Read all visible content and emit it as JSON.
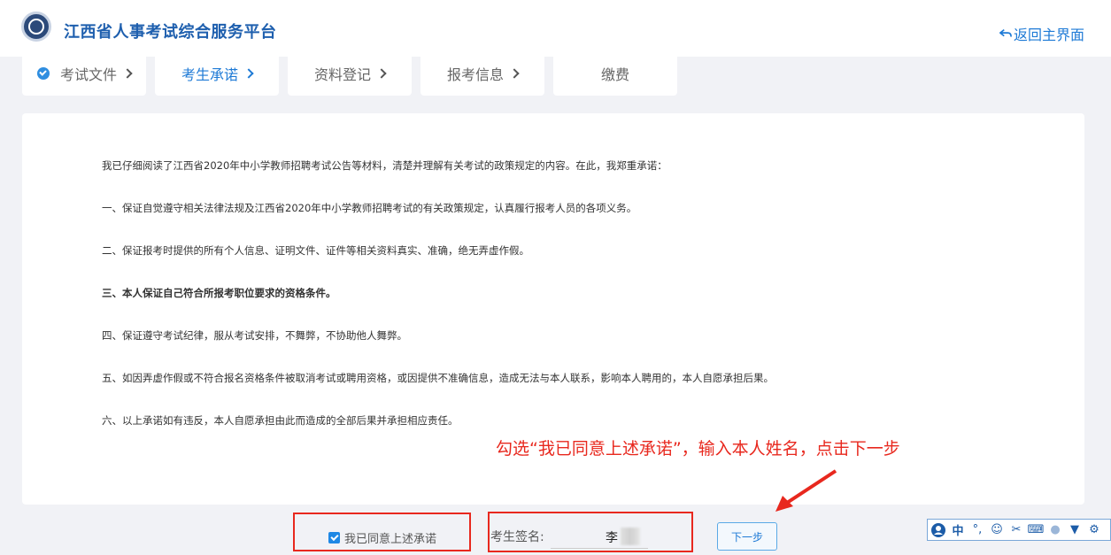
{
  "header": {
    "title": "江西省人事考试综合服务平台",
    "back_label": "返回主界面"
  },
  "steps": [
    {
      "label": "考试文件",
      "state": "done"
    },
    {
      "label": "考生承诺",
      "state": "active"
    },
    {
      "label": "资料登记",
      "state": "pending"
    },
    {
      "label": "报考信息",
      "state": "pending"
    },
    {
      "label": "缴费",
      "state": "pending"
    }
  ],
  "pledge": {
    "intro": "我已仔细阅读了江西省2020年中小学教师招聘考试公告等材料，清楚并理解有关考试的政策规定的内容。在此，我郑重承诺：",
    "items": [
      "一、保证自觉遵守相关法律法规及江西省2020年中小学教师招聘考试的有关政策规定，认真履行报考人员的各项义务。",
      "二、保证报考时提供的所有个人信息、证明文件、证件等相关资料真实、准确，绝无弄虚作假。",
      "三、本人保证自己符合所报考职位要求的资格条件。",
      "四、保证遵守考试纪律，服从考试安排，不舞弊，不协助他人舞弊。",
      "五、如因弄虚作假或不符合报名资格条件被取消考试或聘用资格，或因提供不准确信息，造成无法与本人联系，影响本人聘用的，本人自愿承担后果。",
      "六、以上承诺如有违反，本人自愿承担由此而造成的全部后果并承担相应责任。"
    ]
  },
  "annotation": "勾选“我已同意上述承诺”，输入本人姓名，点击下一步",
  "form": {
    "agree_label": "我已同意上述承诺",
    "agree_checked": true,
    "signature_label": "考生签名:",
    "signature_value": "李",
    "next_label": "下一步"
  },
  "ime_toolbar": {
    "mode_label": "中",
    "icons": [
      "user-icon",
      "chinese-mode",
      "punctuation-icon",
      "emoji-icon",
      "scissors-icon",
      "keyboard-icon",
      "person-icon",
      "shirt-icon",
      "gear-icon"
    ]
  },
  "colors": {
    "accent": "#1e7ad6",
    "annotation_red": "#e8281e"
  }
}
